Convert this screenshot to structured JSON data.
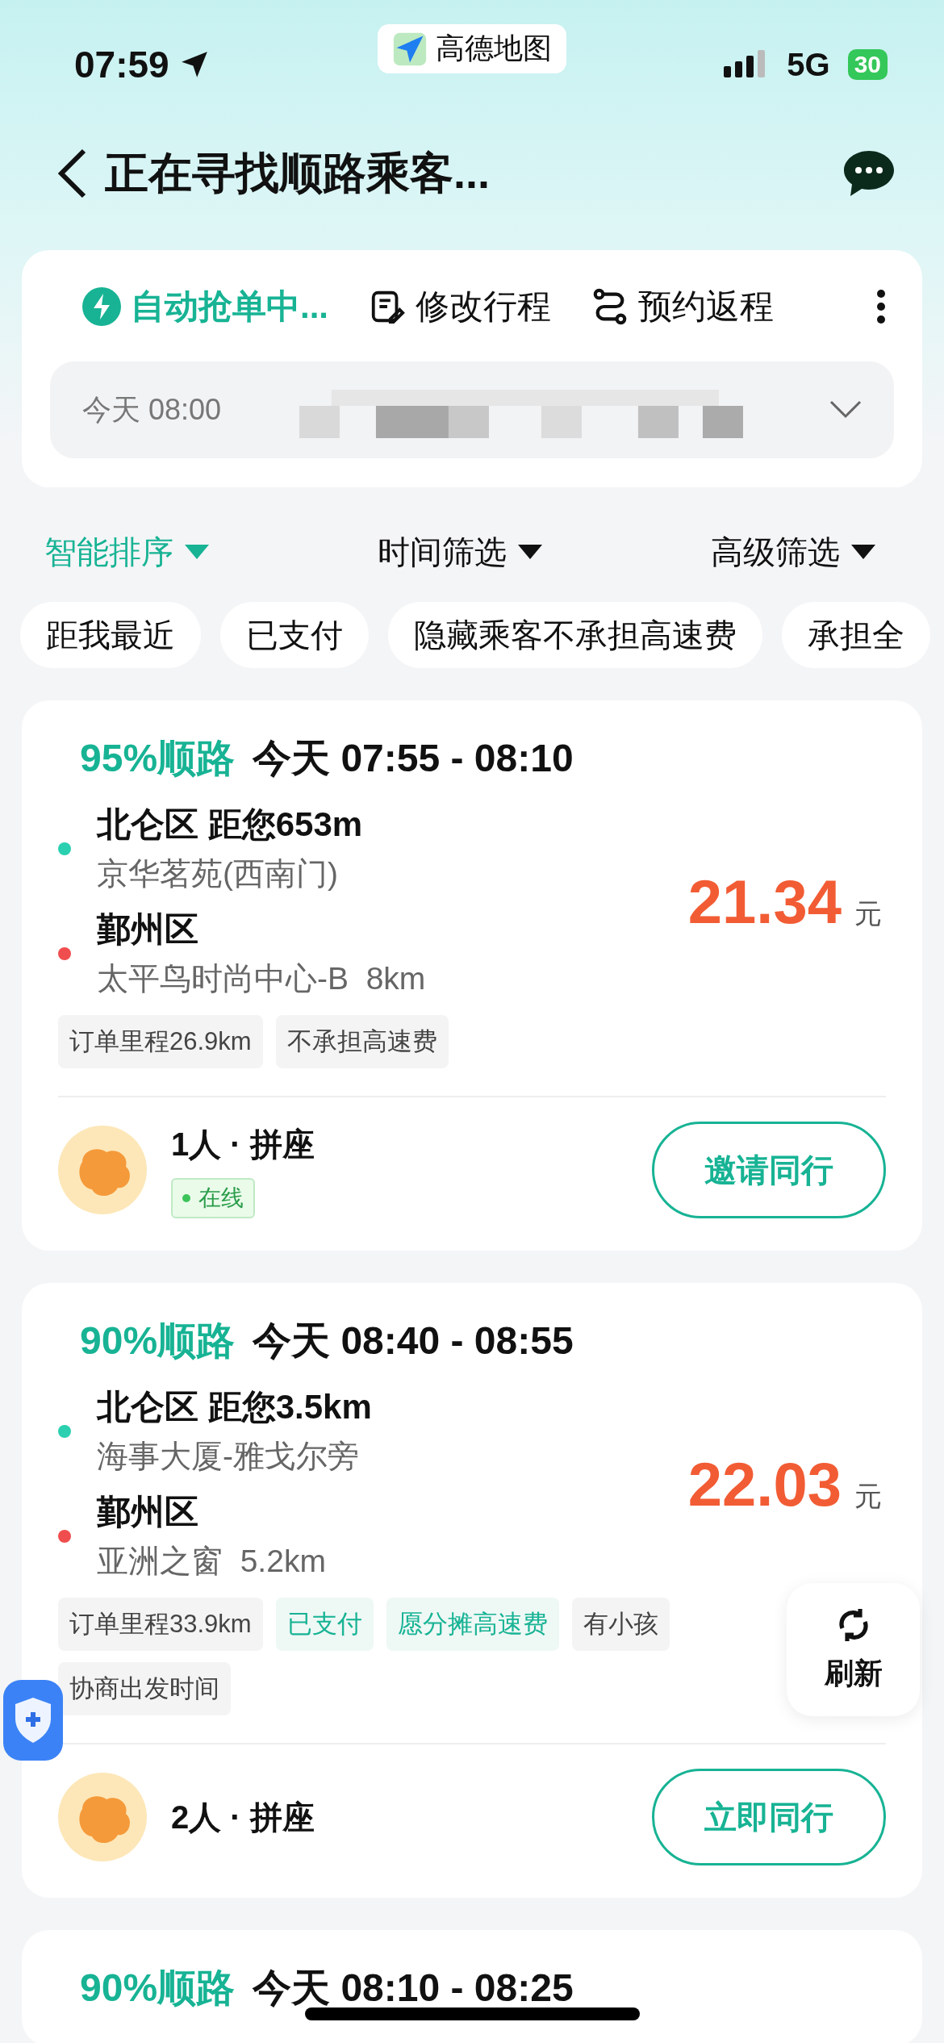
{
  "status_bar": {
    "time": "07:59",
    "app_badge": "高德地图",
    "network": "5G",
    "battery": "30"
  },
  "header": {
    "title": "正在寻找顺路乘客..."
  },
  "trip_panel": {
    "actions": [
      {
        "kind": "auto",
        "label": "自动抢单中..."
      },
      {
        "kind": "edit",
        "label": "修改行程"
      },
      {
        "kind": "return",
        "label": "预约返程"
      }
    ],
    "summary": "今天 08:00"
  },
  "sort_bar": [
    {
      "label": "智能排序",
      "selected": true
    },
    {
      "label": "时间筛选",
      "selected": false
    },
    {
      "label": "高级筛选",
      "selected": false
    }
  ],
  "quick_filters": [
    "距我最近",
    "已支付",
    "隐藏乘客不承担高速费",
    "承担全"
  ],
  "orders": [
    {
      "match": "95%顺路",
      "time": "今天 07:55 - 08:10",
      "pickup": {
        "area": "北仑区 距您653m",
        "address": "京华茗苑(西南门)"
      },
      "dropoff": {
        "area": "鄞州区",
        "address": "太平鸟时尚中心-B  8km"
      },
      "price": "21.34",
      "unit": "元",
      "tags": [
        {
          "label": "订单里程26.9km",
          "kind": "plain"
        },
        {
          "label": "不承担高速费",
          "kind": "plain"
        }
      ],
      "passengers": "1人 · 拼座",
      "status_badge": "在线",
      "action": "邀请同行"
    },
    {
      "match": "90%顺路",
      "time": "今天 08:40 - 08:55",
      "pickup": {
        "area": "北仑区 距您3.5km",
        "address": "海事大厦-雅戈尔旁"
      },
      "dropoff": {
        "area": "鄞州区",
        "address": "亚洲之窗  5.2km"
      },
      "price": "22.03",
      "unit": "元",
      "tags": [
        {
          "label": "订单里程33.9km",
          "kind": "plain"
        },
        {
          "label": "已支付",
          "kind": "accent"
        },
        {
          "label": "愿分摊高速费",
          "kind": "accent"
        },
        {
          "label": "有小孩",
          "kind": "plain"
        },
        {
          "label": "协商出发时间",
          "kind": "plain"
        }
      ],
      "passengers": "2人 · 拼座",
      "action": "立即同行"
    },
    {
      "match": "90%顺路",
      "time": "今天 08:10 - 08:25"
    }
  ],
  "refresh": {
    "label": "刷新"
  }
}
